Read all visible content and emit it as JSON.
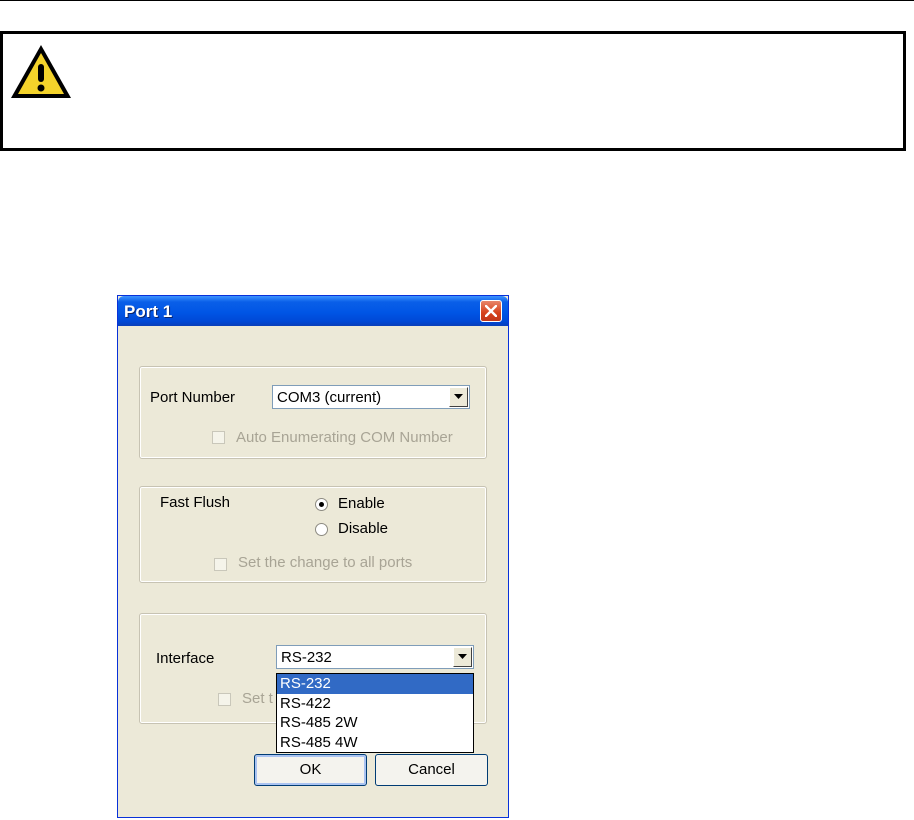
{
  "dialog": {
    "title": "Port 1",
    "port_number": {
      "label": "Port Number",
      "selected": "COM3 (current)",
      "auto_enum_label": "Auto Enumerating COM Number"
    },
    "fast_flush": {
      "label": "Fast Flush",
      "enable_label": "Enable",
      "disable_label": "Disable",
      "selected": "Enable",
      "apply_all_label": "Set the change to all ports"
    },
    "interface": {
      "label": "Interface",
      "selected": "RS-232",
      "options": [
        "RS-232",
        "RS-422",
        "RS-485 2W",
        "RS-485 4W"
      ],
      "hidden_checkbox_label_visible": "Set t"
    },
    "buttons": {
      "ok": "OK",
      "cancel": "Cancel"
    }
  },
  "colors": {
    "titlebar": "#0055e5",
    "dialog_bg": "#ece9d8",
    "selection": "#316ac5",
    "warning_yellow": "#f4d32b"
  },
  "icons": {
    "warning": "warning-triangle-icon",
    "close": "close-icon"
  }
}
